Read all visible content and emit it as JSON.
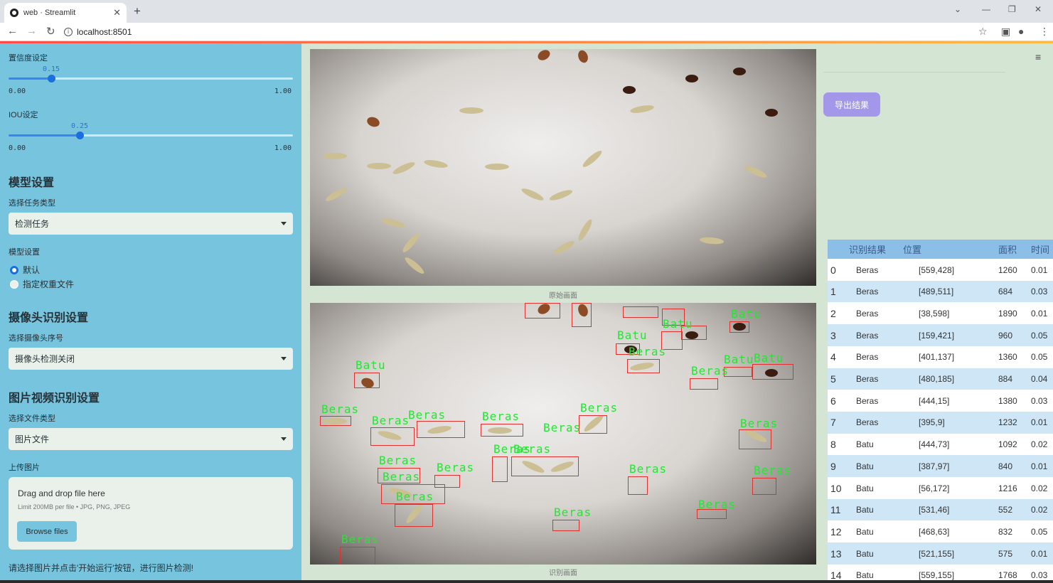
{
  "browser": {
    "tab_title": "web · Streamlit",
    "url": "localhost:8501"
  },
  "sidebar": {
    "conf_label": "置信度设定",
    "conf_value": "0.15",
    "conf_min": "0.00",
    "conf_max": "1.00",
    "conf_fraction": 0.15,
    "iou_label": "IOU设定",
    "iou_value": "0.25",
    "iou_min": "0.00",
    "iou_max": "1.00",
    "iou_fraction": 0.25,
    "model_heading": "模型设置",
    "task_type_label": "选择任务类型",
    "task_type_value": "检测任务",
    "model_setting_label": "模型设置",
    "radio_default": "默认",
    "radio_weights": "指定权重文件",
    "camera_heading": "摄像头识别设置",
    "camera_label": "选择摄像头序号",
    "camera_value": "摄像头检测关闭",
    "media_heading": "图片视频识别设置",
    "file_type_label": "选择文件类型",
    "file_type_value": "图片文件",
    "upload_label": "上传图片",
    "drag_text": "Drag and drop file here",
    "limit_text": "Limit 200MB per file • JPG, PNG, JPEG",
    "browse_label": "Browse files",
    "hint": "请选择图片并点击'开始运行'按钮，进行图片检测!"
  },
  "main": {
    "original_caption": "原始画面",
    "result_caption": "识别画面",
    "export_label": "导出结果",
    "detections": [
      "Batu",
      "Beras",
      "Beras",
      "Beras",
      "Beras",
      "Beras",
      "Beras",
      "Beras",
      "Beras",
      "Beras",
      "Beras",
      "Beras",
      "Beras",
      "Beras",
      "Beras",
      "Beras",
      "Batu",
      "Batu",
      "Batu",
      "Batu",
      "Beras",
      "Beras",
      "Batu",
      "Beras"
    ]
  },
  "table": {
    "headers": [
      "",
      "识别结果",
      "位置",
      "面积",
      "时间"
    ],
    "rows": [
      [
        "0",
        "Beras",
        "[559,428]",
        "1260",
        "0.01"
      ],
      [
        "1",
        "Beras",
        "[489,511]",
        "684",
        "0.03"
      ],
      [
        "2",
        "Beras",
        "[38,598]",
        "1890",
        "0.01"
      ],
      [
        "3",
        "Beras",
        "[159,421]",
        "960",
        "0.05"
      ],
      [
        "4",
        "Beras",
        "[401,137]",
        "1360",
        "0.05"
      ],
      [
        "5",
        "Beras",
        "[480,185]",
        "884",
        "0.04"
      ],
      [
        "6",
        "Beras",
        "[444,15]",
        "1380",
        "0.03"
      ],
      [
        "7",
        "Beras",
        "[395,9]",
        "1232",
        "0.01"
      ],
      [
        "8",
        "Batu",
        "[444,73]",
        "1092",
        "0.02"
      ],
      [
        "9",
        "Batu",
        "[387,97]",
        "840",
        "0.01"
      ],
      [
        "10",
        "Batu",
        "[56,172]",
        "1216",
        "0.02"
      ],
      [
        "11",
        "Batu",
        "[531,46]",
        "552",
        "0.02"
      ],
      [
        "12",
        "Batu",
        "[468,63]",
        "832",
        "0.05"
      ],
      [
        "13",
        "Batu",
        "[521,155]",
        "575",
        "0.01"
      ],
      [
        "14",
        "Batu",
        "[559,155]",
        "1768",
        "0.03"
      ]
    ]
  }
}
